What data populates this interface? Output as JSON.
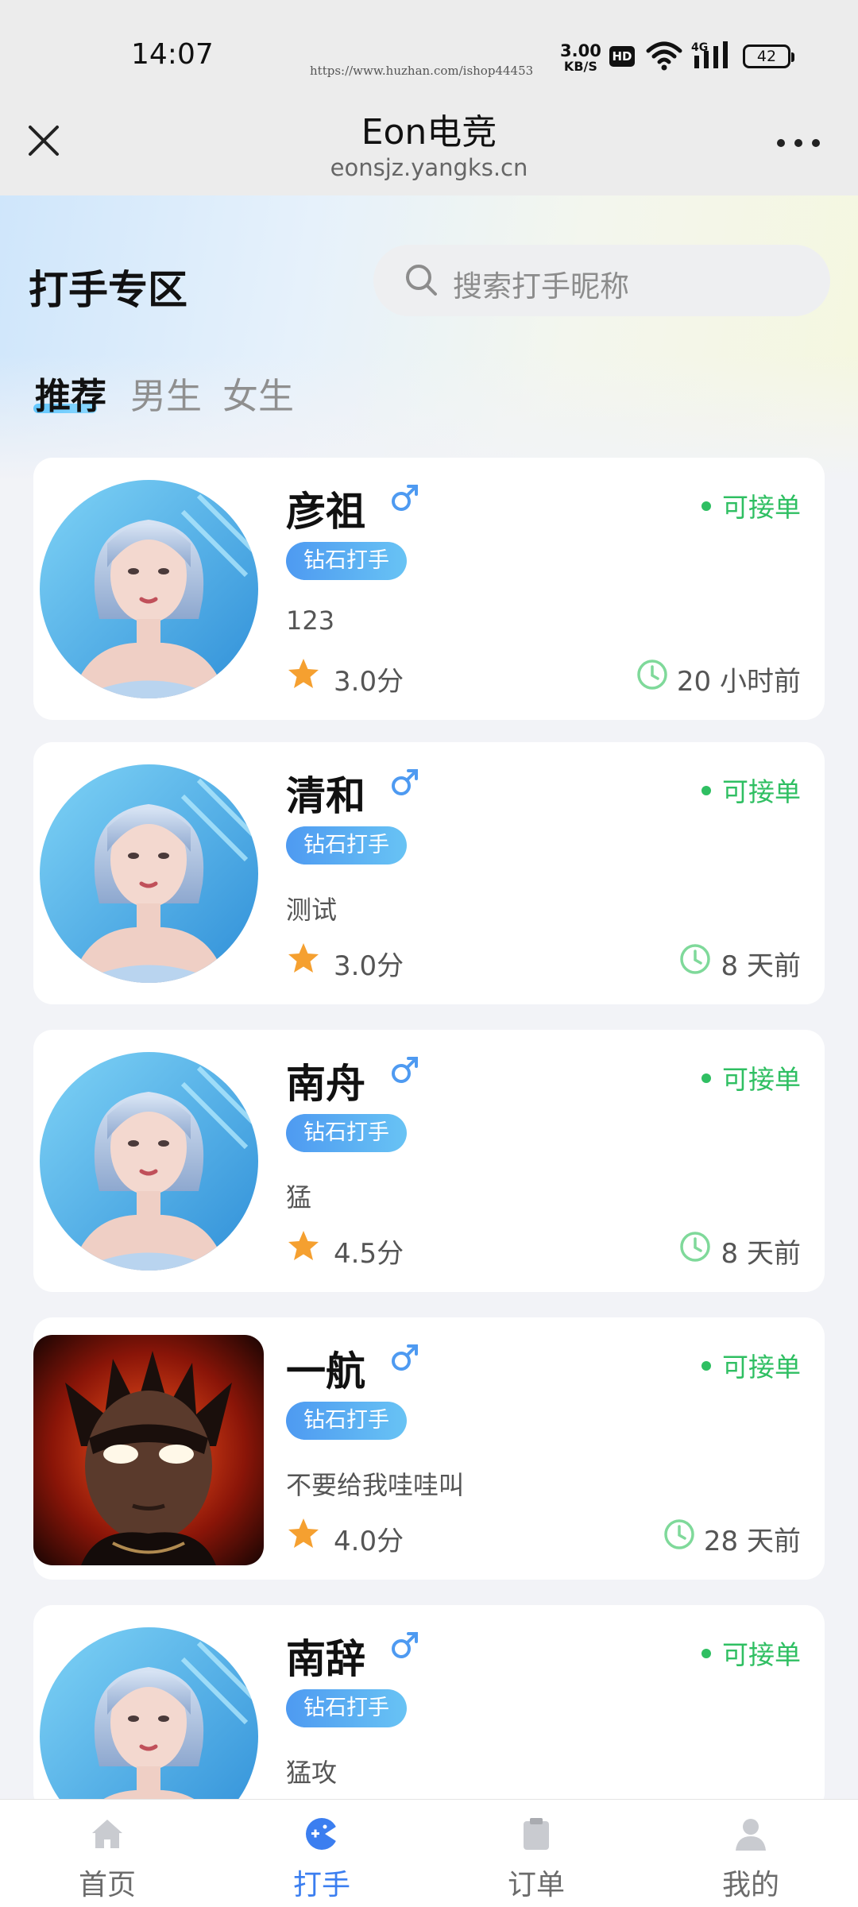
{
  "status_bar": {
    "time": "14:07",
    "watermark": "https://www.huzhan.com/ishop44453",
    "net_speed_value": "3.00",
    "net_speed_unit": "KB/S",
    "hd": "HD",
    "network": "4G",
    "battery": "42"
  },
  "nav": {
    "title": "Eon电竞",
    "url": "eonsjz.yangks.cn"
  },
  "header": {
    "title": "打手专区",
    "search_placeholder": "搜索打手昵称"
  },
  "tabs": [
    {
      "label": "推荐",
      "active": true
    },
    {
      "label": "男生",
      "active": false
    },
    {
      "label": "女生",
      "active": false
    }
  ],
  "players": [
    {
      "name": "彦祖",
      "gender": "♂",
      "badge": "钻石打手",
      "desc": "123",
      "score": "3.0分",
      "status": "可接单",
      "time": "20 小时前",
      "avatar": "anime-girl-silver-hair"
    },
    {
      "name": "清和",
      "gender": "♂",
      "badge": "钻石打手",
      "desc": "测试",
      "score": "3.0分",
      "status": "可接单",
      "time": "8 天前",
      "avatar": "anime-girl-silver-hair"
    },
    {
      "name": "南舟",
      "gender": "♂",
      "badge": "钻石打手",
      "desc": "猛",
      "score": "4.5分",
      "status": "可接单",
      "time": "8 天前",
      "avatar": "anime-girl-silver-hair"
    },
    {
      "name": "一航",
      "gender": "♂",
      "badge": "钻石打手",
      "desc": "不要给我哇哇叫",
      "score": "4.0分",
      "status": "可接单",
      "time": "28 天前",
      "avatar": "dark-hero-glowing-eyes"
    },
    {
      "name": "南辞",
      "gender": "♂",
      "badge": "钻石打手",
      "desc": "猛攻",
      "score": "",
      "status": "可接单",
      "time": "",
      "avatar": "anime-girl-silver-hair"
    }
  ],
  "bottom_nav": [
    {
      "label": "首页",
      "icon": "home-icon",
      "active": false
    },
    {
      "label": "打手",
      "icon": "gamepad-icon",
      "active": true
    },
    {
      "label": "订单",
      "icon": "clipboard-icon",
      "active": false
    },
    {
      "label": "我的",
      "icon": "user-icon",
      "active": false
    }
  ],
  "colors": {
    "accent": "#3b7ef0",
    "available": "#2fbf62",
    "badge_start": "#4e9af1",
    "badge_end": "#68c3f4",
    "star": "#f5a030"
  }
}
